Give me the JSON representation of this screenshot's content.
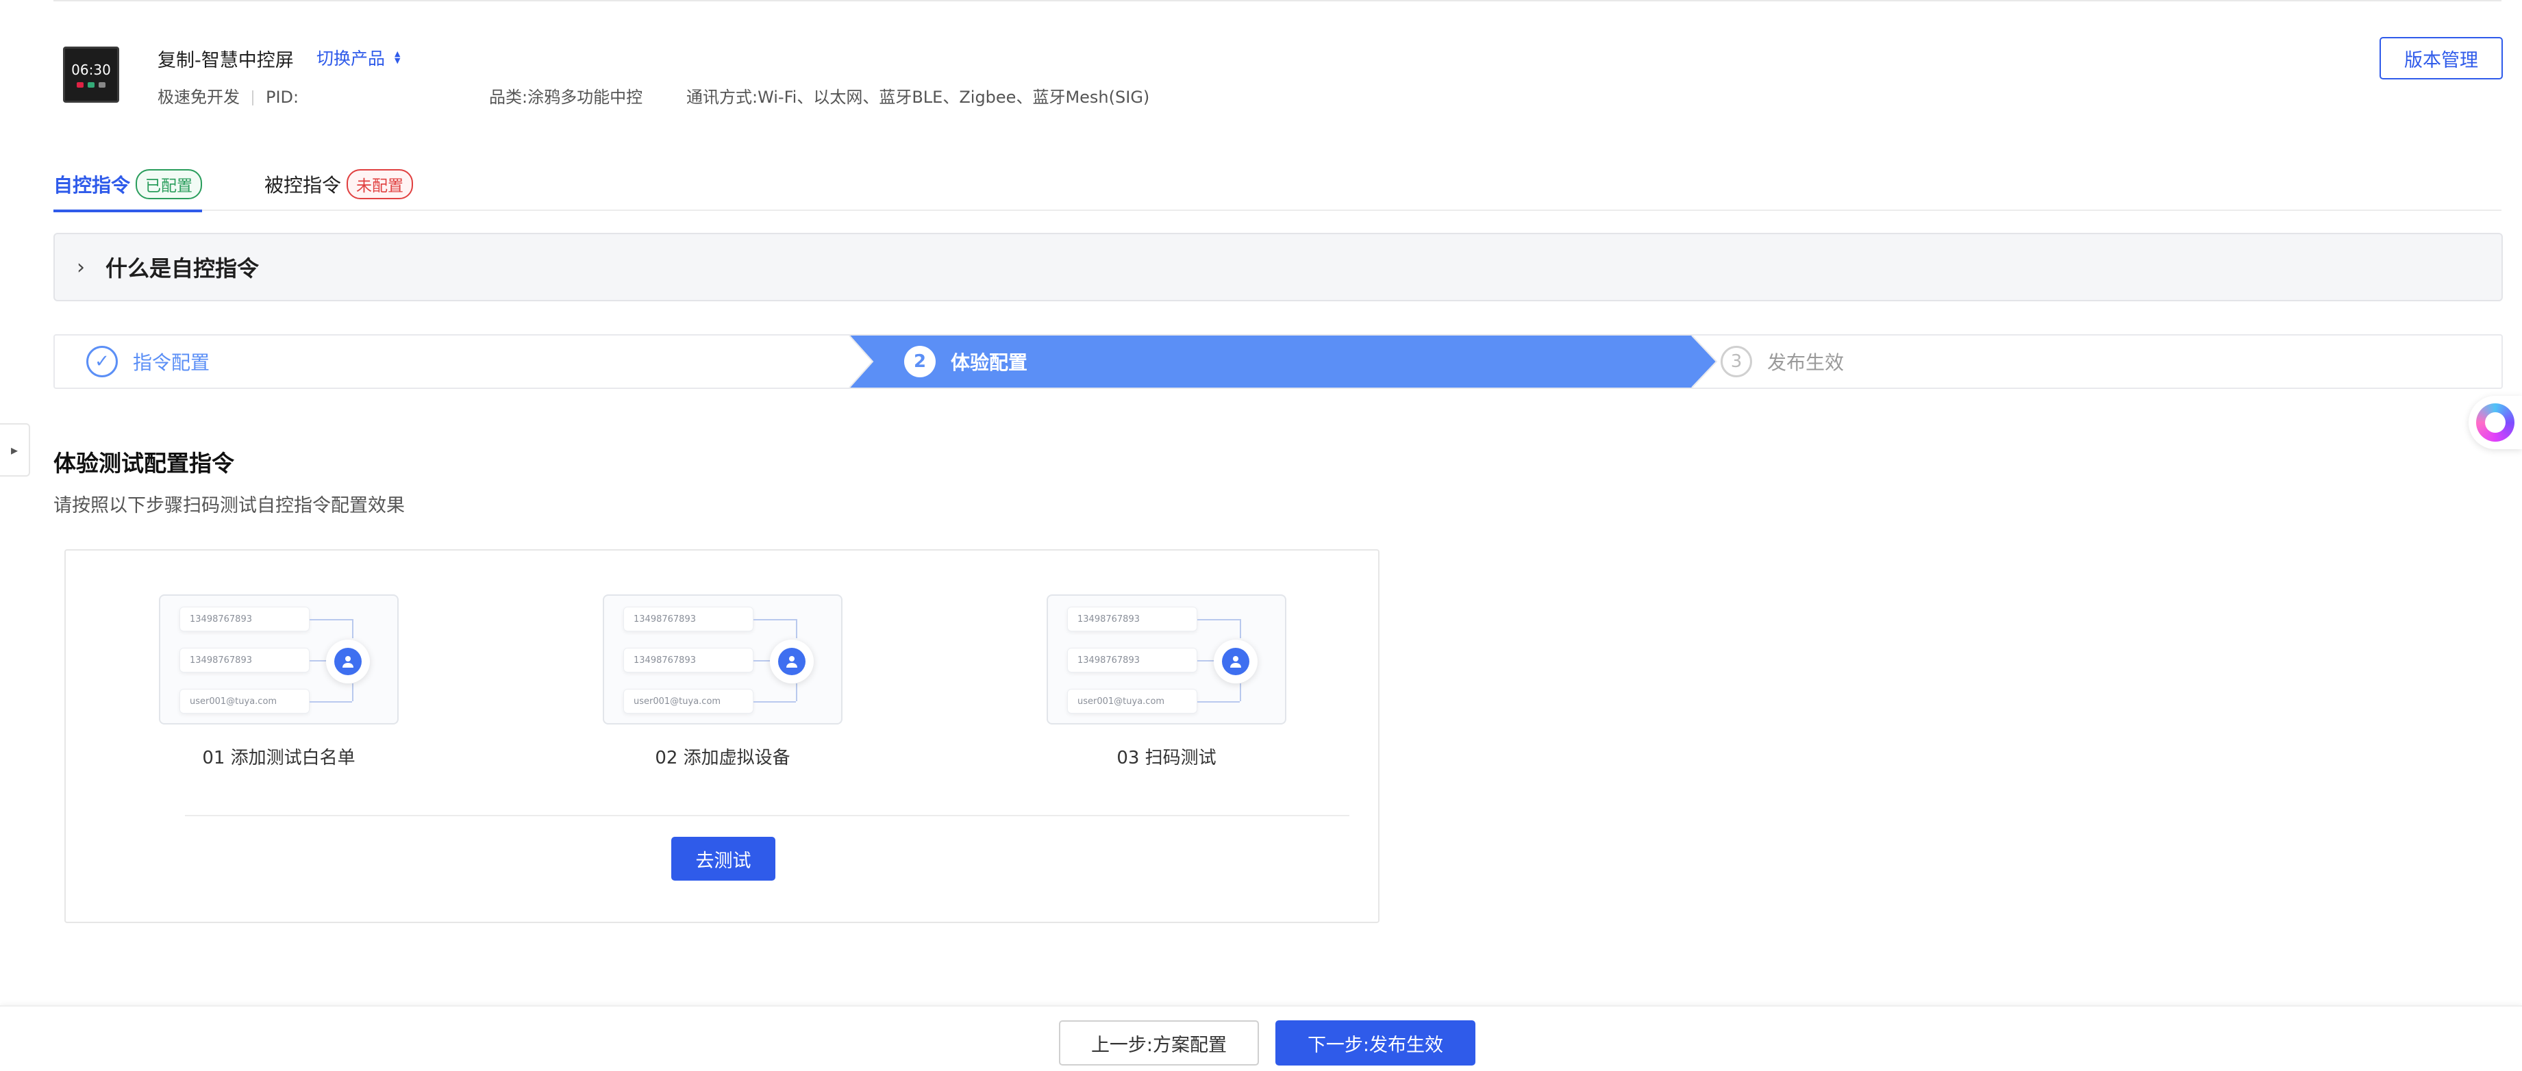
{
  "product": {
    "thumb_time": "06:30",
    "name": "复制-智慧中控屏",
    "switch_label": "切换产品",
    "dev_mode": "极速免开发",
    "pid_label": "PID:",
    "category": "品类:涂鸦多功能中控",
    "protocols": "通讯方式:Wi-Fi、以太网、蓝牙BLE、Zigbee、蓝牙Mesh(SIG)"
  },
  "header": {
    "version_button": "版本管理"
  },
  "tabs": [
    {
      "label": "自控指令",
      "badge": "已配置",
      "active": true
    },
    {
      "label": "被控指令",
      "badge": "未配置",
      "active": false
    }
  ],
  "collapse": {
    "title": "什么是自控指令"
  },
  "steps": [
    {
      "label": "指令配置",
      "status": "done",
      "index": "1"
    },
    {
      "label": "体验配置",
      "status": "current",
      "index": "2"
    },
    {
      "label": "发布生效",
      "status": "todo",
      "index": "3"
    }
  ],
  "section": {
    "title": "体验测试配置指令",
    "description": "请按照以下步骤扫码测试自控指令配置效果"
  },
  "flow": [
    {
      "label": "01 添加测试白名单",
      "rows": [
        "13498767893",
        "13498767893",
        "user001@tuya.com"
      ]
    },
    {
      "label": "02 添加虚拟设备",
      "rows": [
        "13498767893",
        "13498767893",
        "user001@tuya.com"
      ]
    },
    {
      "label": "03 扫码测试",
      "rows": [
        "13498767893",
        "13498767893",
        "user001@tuya.com"
      ]
    }
  ],
  "card": {
    "test_button": "去测试"
  },
  "footer": {
    "prev_button": "上一步:方案配置",
    "next_button": "下一步:发布生效"
  },
  "colors": {
    "primary": "#2f5bea",
    "step_active": "#5b8ff6",
    "success": "#2a9d5c",
    "danger": "#e04040"
  },
  "icons": {
    "switch": "sort-arrows-icon",
    "collapse": "chevron-right-icon",
    "step_done": "check-circle-icon",
    "side_toggle": "caret-right-icon",
    "assistant": "ai-assistant-icon",
    "avatar": "user-icon"
  }
}
